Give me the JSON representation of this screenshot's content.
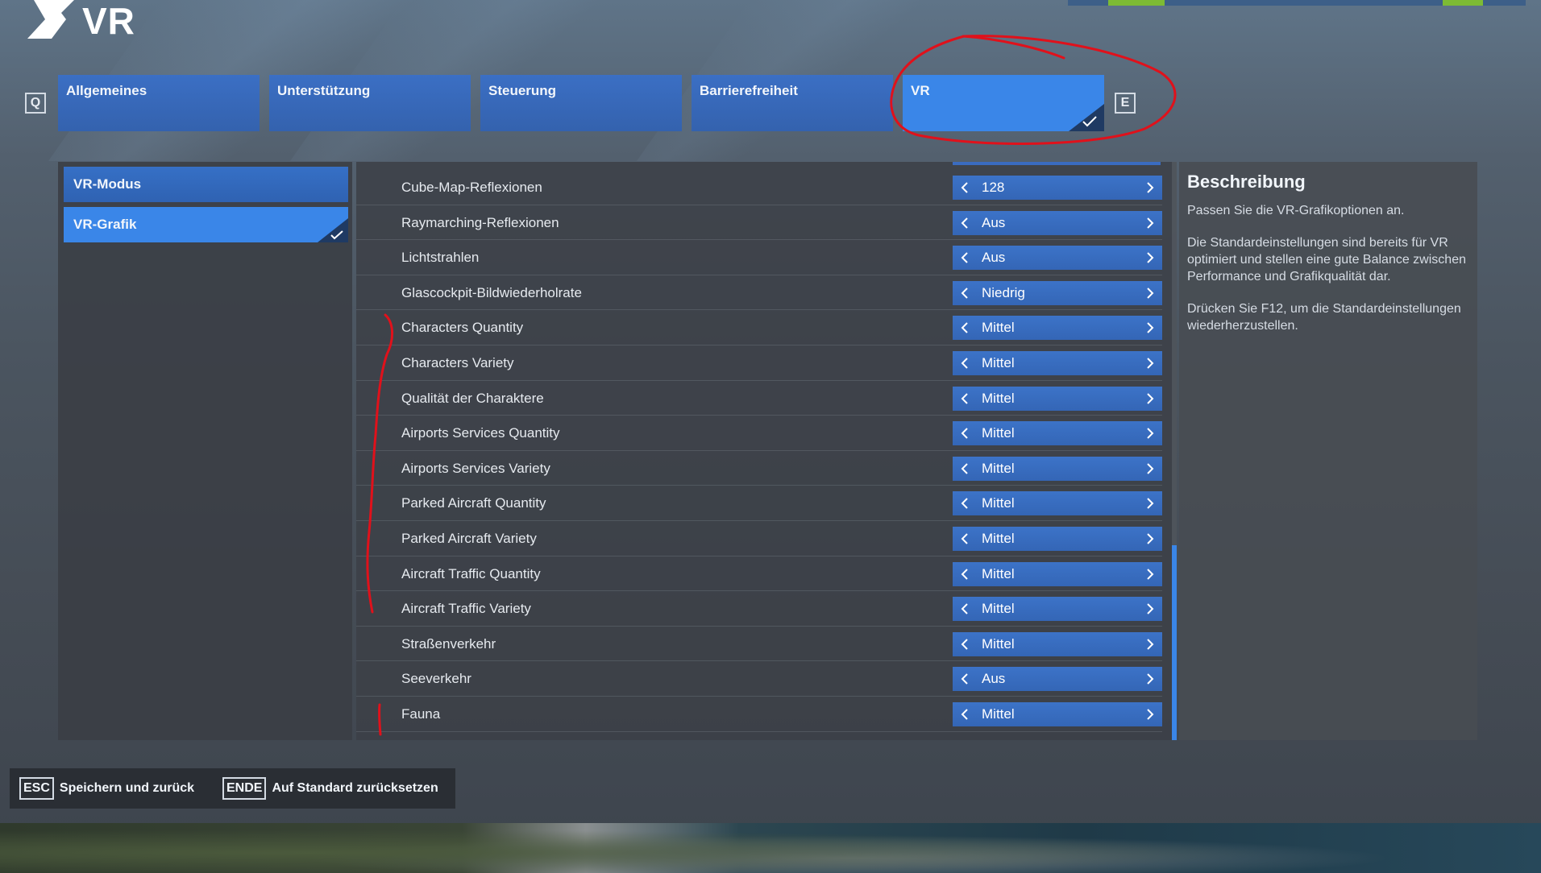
{
  "page_title": "VR",
  "keys": {
    "prev_tab": "Q",
    "next_tab": "E"
  },
  "tabs": [
    {
      "label": "Allgemeines",
      "active": false
    },
    {
      "label": "Unterstützung",
      "active": false
    },
    {
      "label": "Steuerung",
      "active": false
    },
    {
      "label": "Barrierefreiheit",
      "active": false
    },
    {
      "label": "VR",
      "active": true
    }
  ],
  "categories": [
    {
      "label": "VR-Modus",
      "selected": false
    },
    {
      "label": "VR-Grafik",
      "selected": true
    }
  ],
  "settings": [
    {
      "label": "Cube-Map-Reflexionen",
      "value": "128"
    },
    {
      "label": "Raymarching-Reflexionen",
      "value": "Aus"
    },
    {
      "label": "Lichtstrahlen",
      "value": "Aus"
    },
    {
      "label": "Glascockpit-Bildwiederholrate",
      "value": "Niedrig"
    },
    {
      "label": "Characters Quantity",
      "value": "Mittel"
    },
    {
      "label": "Characters Variety",
      "value": "Mittel"
    },
    {
      "label": "Qualität der Charaktere",
      "value": "Mittel"
    },
    {
      "label": "Airports Services Quantity",
      "value": "Mittel"
    },
    {
      "label": "Airports Services Variety",
      "value": "Mittel"
    },
    {
      "label": "Parked Aircraft Quantity",
      "value": "Mittel"
    },
    {
      "label": "Parked Aircraft Variety",
      "value": "Mittel"
    },
    {
      "label": "Aircraft Traffic Quantity",
      "value": "Mittel"
    },
    {
      "label": "Aircraft Traffic Variety",
      "value": "Mittel"
    },
    {
      "label": "Straßenverkehr",
      "value": "Mittel"
    },
    {
      "label": "Seeverkehr",
      "value": "Aus"
    },
    {
      "label": "Fauna",
      "value": "Mittel"
    }
  ],
  "description": {
    "title": "Beschreibung",
    "paragraphs": [
      "Passen Sie die VR-Grafikoptionen an.",
      "Die Standardeinstellungen sind bereits für VR optimiert und stellen eine gute Balance zwischen Performance und Grafikqualität dar.",
      "Drücken Sie F12, um die Standardeinstellungen wiederherzustellen."
    ]
  },
  "footer": {
    "save_key": "ESC",
    "save_label": "Speichern und zurück",
    "reset_key": "ENDE",
    "reset_label": "Auf Standard zurücksetzen"
  },
  "colors": {
    "accent_active": "#3a86e8",
    "tab_blue": "#3462ae",
    "annotation_red": "#e0111b"
  },
  "icons": {
    "check": "check-icon",
    "arrow_left": "chevron-left-icon",
    "arrow_right": "chevron-right-icon",
    "logo": "chevron-logo-icon"
  }
}
